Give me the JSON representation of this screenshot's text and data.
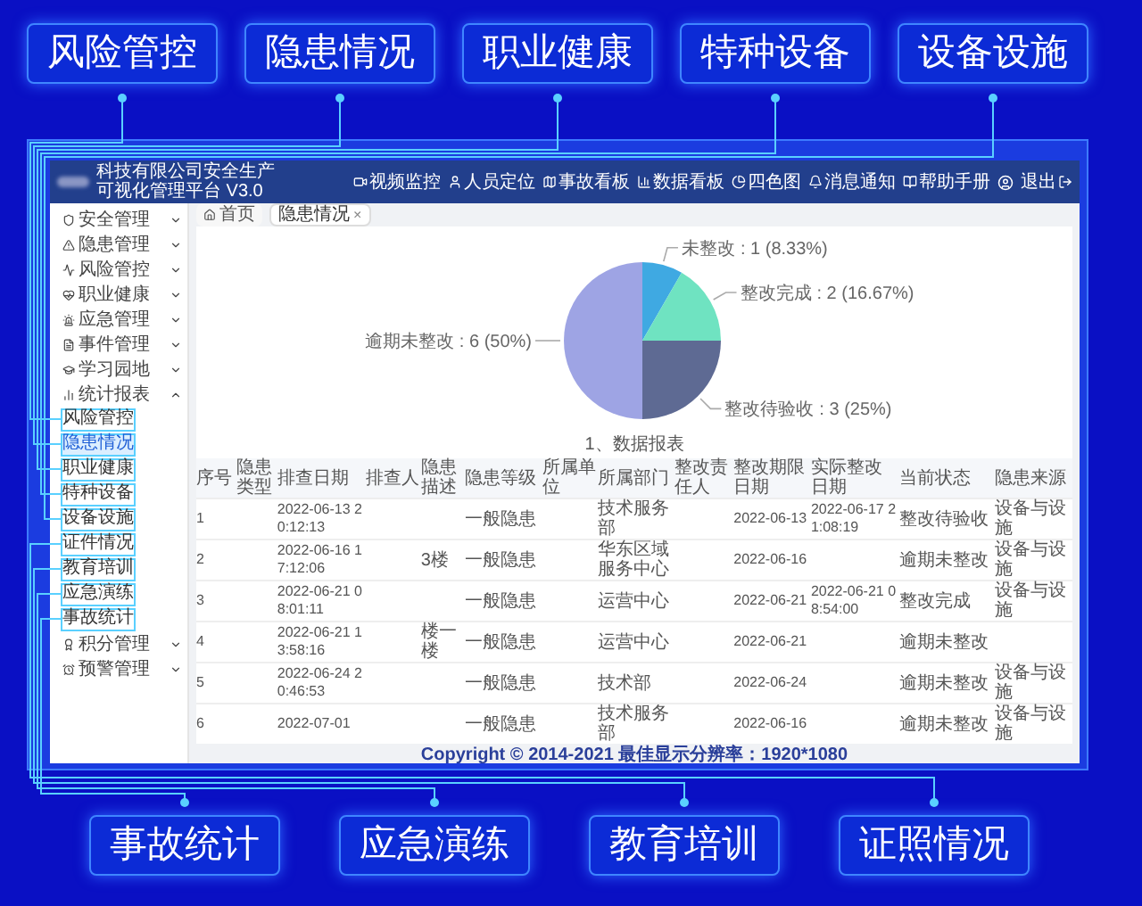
{
  "top_labels": [
    "风险管控",
    "隐患情况",
    "职业健康",
    "特种设备",
    "设备设施"
  ],
  "app": {
    "title": "科技有限公司安全生产可视化管理平台",
    "version": "V3.0",
    "nav": [
      "视频监控",
      "人员定位",
      "事故看板",
      "数据看板",
      "四色图",
      "消息通知",
      "帮助手册"
    ],
    "logout": "退出",
    "sidebar": {
      "items": [
        {
          "label": "安全管理",
          "expanded": false
        },
        {
          "label": "隐患管理",
          "expanded": false
        },
        {
          "label": "风险管控",
          "expanded": false
        },
        {
          "label": "职业健康",
          "expanded": false
        },
        {
          "label": "应急管理",
          "expanded": false
        },
        {
          "label": "事件管理",
          "expanded": false
        },
        {
          "label": "学习园地",
          "expanded": false
        },
        {
          "label": "统计报表",
          "expanded": true,
          "children": [
            {
              "label": "风险管控",
              "selected": false
            },
            {
              "label": "隐患情况",
              "selected": true
            },
            {
              "label": "职业健康",
              "selected": false
            },
            {
              "label": "特种设备",
              "selected": false
            },
            {
              "label": "设备设施",
              "selected": false
            },
            {
              "label": "证件情况",
              "selected": false
            },
            {
              "label": "教育培训",
              "selected": false
            },
            {
              "label": "应急演练",
              "selected": false
            },
            {
              "label": "事故统计",
              "selected": false
            }
          ]
        },
        {
          "label": "积分管理",
          "expanded": false
        },
        {
          "label": "预警管理",
          "expanded": false
        }
      ]
    },
    "tabs": [
      {
        "label": "首页",
        "selected": false
      },
      {
        "label": "隐患情况",
        "selected": true,
        "close": "×"
      }
    ],
    "chart": {
      "chart_data": {
        "type": "pie",
        "categories": [
          "未整改",
          "整改完成",
          "整改待验收",
          "逾期未整改"
        ],
        "values": [
          1,
          2,
          3,
          6
        ],
        "colors": [
          "#3fa9e2",
          "#6fe3c1",
          "#5e6a93",
          "#9ea4e4"
        ],
        "value_labels": [
          ": 1 (8.33%)",
          ": 2 (16.67%)",
          ": 3 (25%)",
          ": 6 (50%)"
        ]
      }
    },
    "table": {
      "title": "1、数据报表",
      "columns": [
        "序号",
        "隐患类型",
        "排查日期",
        "排查人",
        "隐患描述",
        "隐患等级",
        "所属单位",
        "所属部门",
        "整改责任人",
        "整改期限日期",
        "实际整改日期",
        "当前状态",
        "隐患来源"
      ],
      "rows": [
        [
          "1",
          null,
          "2022-06-13 20:12:13",
          null,
          null,
          "一般隐患",
          null,
          "技术服务部",
          null,
          "2022-06-13",
          "2022-06-17 21:08:19",
          "整改待验收",
          "设备与设施"
        ],
        [
          "2",
          null,
          "2022-06-16 17:12:06",
          null,
          "3楼",
          "一般隐患",
          null,
          "华东区域服务中心",
          null,
          "2022-06-16",
          null,
          "逾期未整改",
          "设备与设施"
        ],
        [
          "3",
          null,
          "2022-06-21 08:01:11",
          null,
          null,
          "一般隐患",
          null,
          "运营中心",
          null,
          "2022-06-21",
          "2022-06-21 08:54:00",
          "整改完成",
          "设备与设施"
        ],
        [
          "4",
          null,
          "2022-06-21 13:58:16",
          null,
          "楼一楼",
          "一般隐患",
          null,
          "运营中心",
          null,
          "2022-06-21",
          null,
          "逾期未整改",
          null
        ],
        [
          "5",
          null,
          "2022-06-24 20:46:53",
          null,
          null,
          "一般隐患",
          null,
          "技术部",
          null,
          "2022-06-24",
          null,
          "逾期未整改",
          "设备与设施"
        ],
        [
          "6",
          null,
          "2022-07-01",
          null,
          null,
          "一般隐患",
          null,
          "技术服务部",
          null,
          "2022-06-16",
          null,
          "逾期未整改",
          "设备与设施"
        ]
      ]
    },
    "footer": "Copyright © 2014-2021 最佳显示分辨率：1920*1080"
  },
  "bottom_labels": [
    "事故统计",
    "应急演练",
    "教育培训",
    "证照情况"
  ]
}
